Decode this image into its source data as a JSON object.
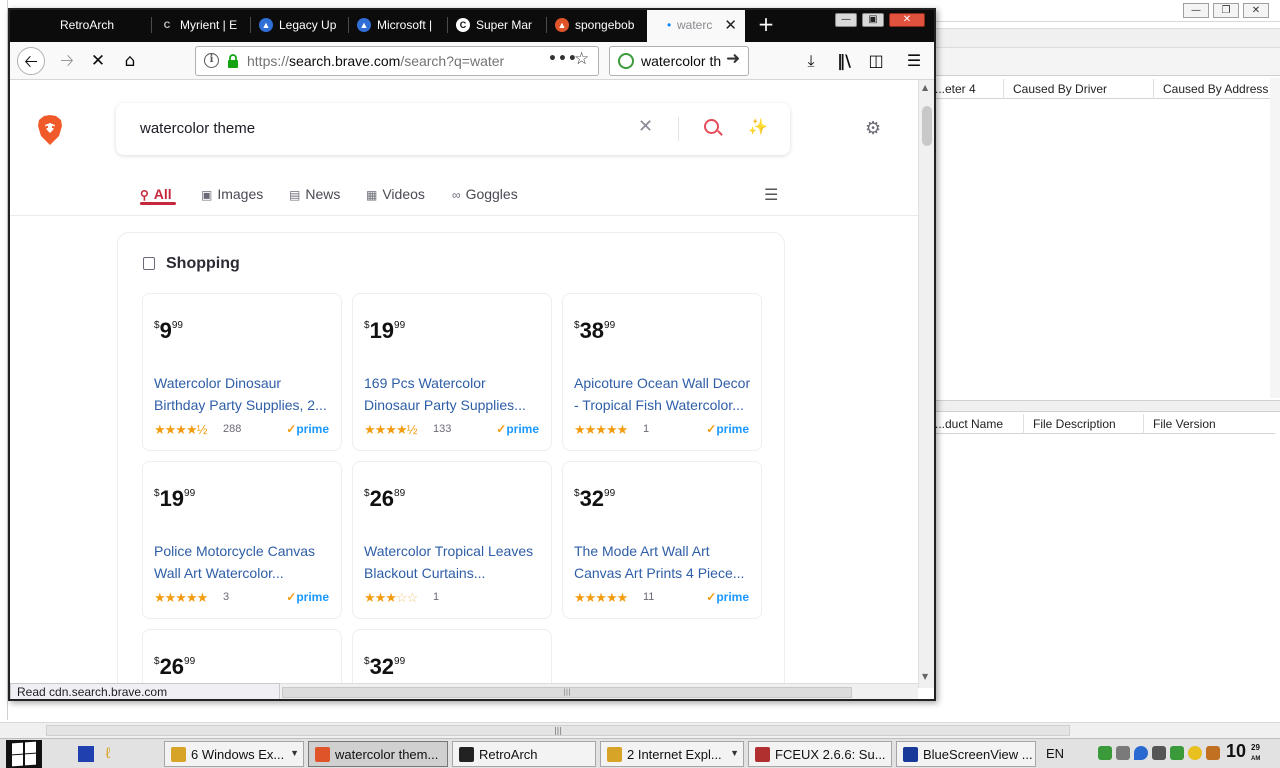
{
  "background_window": {
    "list_headers_top": [
      "...eter 4",
      "Caused By Driver",
      "Caused By Address"
    ],
    "list_headers_bottom": [
      "...duct Name",
      "File Description",
      "File Version"
    ]
  },
  "browser": {
    "tabs": [
      {
        "label": "RetroArch"
      },
      {
        "label": "Myrient | E"
      },
      {
        "label": "Legacy Up"
      },
      {
        "label": "Microsoft |"
      },
      {
        "label": "Super Mar"
      },
      {
        "label": "spongebob"
      },
      {
        "label": "waterc"
      }
    ],
    "url": {
      "scheme": "https://",
      "host": "search.brave.com",
      "path": "/search?q=water"
    },
    "search_field": "watercolor th",
    "status_text": "Read cdn.search.brave.com"
  },
  "page": {
    "query": "watercolor theme",
    "tabs": [
      {
        "label": "All",
        "icon": "search-icon"
      },
      {
        "label": "Images",
        "icon": "image-icon"
      },
      {
        "label": "News",
        "icon": "news-icon"
      },
      {
        "label": "Videos",
        "icon": "film-icon"
      },
      {
        "label": "Goggles",
        "icon": "goggles-icon"
      }
    ],
    "shopping": {
      "title": "Shopping",
      "currency": "$",
      "prime_label": "prime",
      "products": [
        {
          "dollars": "9",
          "cents": "99",
          "name_line1": "Watercolor Dinosaur",
          "name_line2": "Birthday Party Supplies, 2...",
          "stars": "★★★★½",
          "empty_stars": "",
          "count": "288",
          "prime": true
        },
        {
          "dollars": "19",
          "cents": "99",
          "name_line1": "169 Pcs Watercolor",
          "name_line2": "Dinosaur Party Supplies...",
          "stars": "★★★★½",
          "empty_stars": "",
          "count": "133",
          "prime": true
        },
        {
          "dollars": "38",
          "cents": "99",
          "name_line1": "Apicoture Ocean Wall Decor",
          "name_line2": "- Tropical Fish Watercolor...",
          "stars": "★★★★★",
          "empty_stars": "",
          "count": "1",
          "prime": true
        },
        {
          "dollars": "19",
          "cents": "99",
          "name_line1": "Police Motorcycle Canvas",
          "name_line2": "Wall Art Watercolor...",
          "stars": "★★★★★",
          "empty_stars": "",
          "count": "3",
          "prime": true
        },
        {
          "dollars": "26",
          "cents": "89",
          "name_line1": "Watercolor Tropical Leaves",
          "name_line2": "Blackout Curtains...",
          "stars": "★★★",
          "empty_stars": "☆☆",
          "count": "1",
          "prime": false
        },
        {
          "dollars": "32",
          "cents": "99",
          "name_line1": "The Mode Art Wall Art",
          "name_line2": "Canvas Art Prints 4 Piece...",
          "stars": "★★★★★",
          "empty_stars": "",
          "count": "11",
          "prime": true
        },
        {
          "dollars": "26",
          "cents": "99"
        },
        {
          "dollars": "32",
          "cents": "99"
        }
      ]
    }
  },
  "taskbar": {
    "items": [
      {
        "label": "6 Windows Ex...",
        "icon": "folder-icon",
        "color": "#d8a428"
      },
      {
        "label": "watercolor them...",
        "icon": "brave-icon",
        "color": "#e0542a"
      },
      {
        "label": "RetroArch",
        "icon": "retroarch-icon",
        "color": "#222222"
      },
      {
        "label": "2 Internet Expl...",
        "icon": "ie-icon",
        "color": "#d8a428"
      },
      {
        "label": "FCEUX 2.6.6: Su...",
        "icon": "fceux-icon",
        "color": "#b03030"
      },
      {
        "label": "BlueScreenView ...",
        "icon": "bluescreen-icon",
        "color": "#1a3a9a"
      }
    ],
    "language": "EN",
    "clock_hour": "10",
    "clock_minute": "29",
    "clock_ampm": "AM"
  }
}
